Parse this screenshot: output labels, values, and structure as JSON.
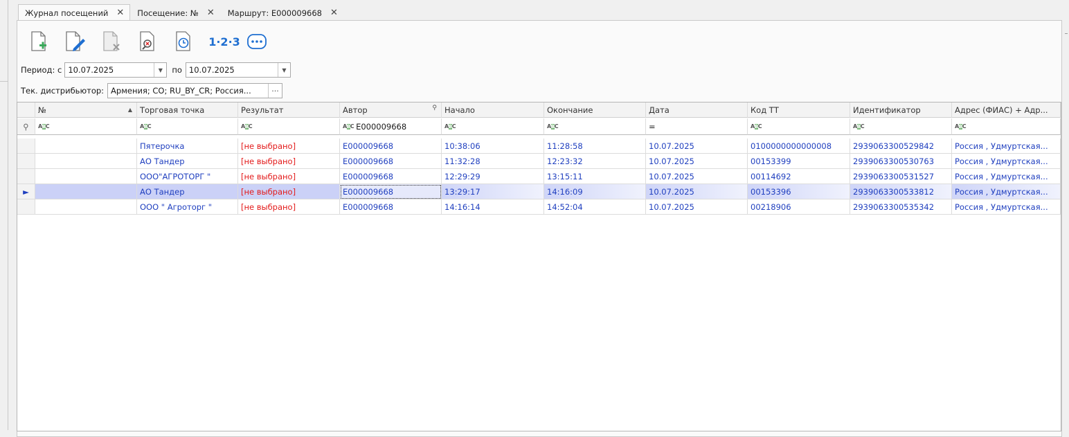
{
  "tabs": [
    {
      "label": "Журнал посещений",
      "close": "✕"
    },
    {
      "label": "Посещение: №",
      "close": "✕"
    },
    {
      "label": "Маршрут: Е000009668",
      "close": "✕"
    }
  ],
  "toolbar": {
    "buttons": [
      "add-document-icon",
      "edit-document-icon",
      "delete-document-icon",
      "find-clear-icon",
      "history-clock-icon"
    ],
    "numbering_label": "1·2·3",
    "more_label": "···"
  },
  "period": {
    "label": "Период: с",
    "from": "10.07.2025",
    "to_label": "по",
    "to": "10.07.2025"
  },
  "distributor": {
    "label": "Тек. дистрибьютор:",
    "value": "Армения; СО; RU_BY_CR; Россия..."
  },
  "grid": {
    "columns": [
      "№",
      "Торговая точка",
      "Результат",
      "Автор",
      "Начало",
      "Окончание",
      "Дата",
      "Код ТТ",
      "Идентификатор",
      "Адрес (ФИАС) + Адр..."
    ],
    "filter_author": "Е000009668",
    "filter_date_op": "=",
    "rows": [
      {
        "num": "",
        "point": "Пятерочка",
        "result": "[не выбрано]",
        "author": "Е000009668",
        "start": "10:38:06",
        "end": "11:28:58",
        "date": "10.07.2025",
        "code": "0100000000000008",
        "id": "2939063300529842",
        "address": "Россия , Удмуртская..."
      },
      {
        "num": "",
        "point": "АО Тандер",
        "result": "[не выбрано]",
        "author": "Е000009668",
        "start": "11:32:28",
        "end": "12:23:32",
        "date": "10.07.2025",
        "code": "00153399",
        "id": "2939063300530763",
        "address": "Россия , Удмуртская..."
      },
      {
        "num": "",
        "point": "ООО\"АГРОТОРГ \"",
        "result": "[не выбрано]",
        "author": "Е000009668",
        "start": "12:29:29",
        "end": "13:15:11",
        "date": "10.07.2025",
        "code": "00114692",
        "id": "2939063300531527",
        "address": "Россия , Удмуртская..."
      },
      {
        "num": "",
        "point": "АО Тандер",
        "result": "[не выбрано]",
        "author": "Е000009668",
        "start": "13:29:17",
        "end": "14:16:09",
        "date": "10.07.2025",
        "code": "00153396",
        "id": "2939063300533812",
        "address": "Россия , Удмуртская..."
      },
      {
        "num": "",
        "point": "ООО \" Агроторг \"",
        "result": "[не выбрано]",
        "author": "Е000009668",
        "start": "14:16:14",
        "end": "14:52:04",
        "date": "10.07.2025",
        "code": "00218906",
        "id": "2939063300535342",
        "address": "Россия , Удмуртская..."
      }
    ],
    "selected_row": 3
  },
  "colors": {
    "link_text": "#1f3fbf",
    "result_text": "#e31b1b",
    "selected_row": "#cbd1f7",
    "accent_blue": "#1f6fd1"
  }
}
